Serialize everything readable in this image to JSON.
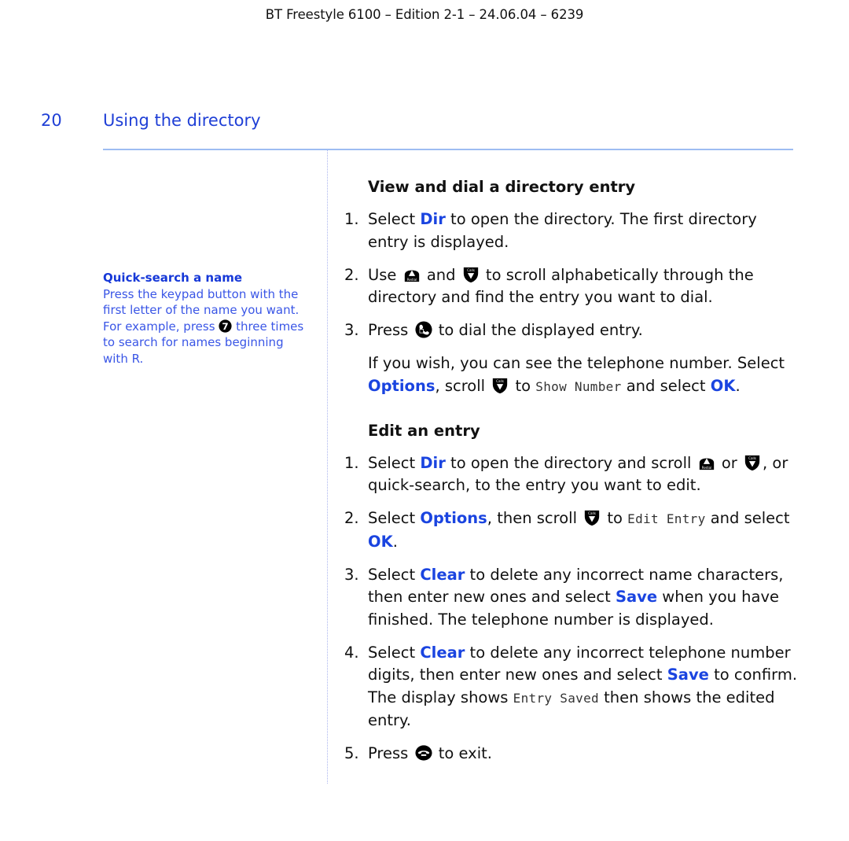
{
  "header": {
    "text": "BT Freestyle 6100 – Edition 2-1 – 24.06.04 – 6239"
  },
  "page": {
    "number": "20",
    "section_title": "Using the directory"
  },
  "colors": {
    "accent": "#1a44e0",
    "rule": "#9dbcf2",
    "sidebar_text": "#3a56e6"
  },
  "sidebar": {
    "title": "Quick-search a name",
    "text_before": "Press the keypad button with the first letter of the name you want. For example, press ",
    "key_icon": "key-7-icon",
    "text_after": " three times to search for names beginning with R."
  },
  "view_section": {
    "heading": "View and dial a directory entry",
    "steps": [
      {
        "num": "1.",
        "parts": [
          "Select ",
          "Dir",
          " to open the directory. The first directory entry is displayed."
        ]
      },
      {
        "num": "2.",
        "parts": [
          "Use ",
          " and ",
          " to scroll alphabetically through the directory and find the entry you want to dial."
        ],
        "icons": [
          "redial-up-icon",
          "calls-down-icon"
        ]
      },
      {
        "num": "3.",
        "parts": [
          "Press ",
          " to dial the displayed entry."
        ],
        "icons": [
          "talk-icon"
        ]
      }
    ],
    "note": {
      "t1": "If you wish, you can see the telephone number. Select ",
      "kw1": "Options",
      "t2": ", scroll ",
      "t3": " to ",
      "lcd": "Show Number",
      "t4": " and select ",
      "kw2": "OK",
      "t5": "."
    }
  },
  "edit_section": {
    "heading": "Edit an entry",
    "step1": {
      "num": "1.",
      "t1": "Select ",
      "kw1": "Dir",
      "t2": " to open the directory and scroll ",
      "t3": " or ",
      "t4": ", or quick-search, to the entry you want to edit."
    },
    "step2": {
      "num": "2.",
      "t1": "Select ",
      "kw1": "Options",
      "t2": ", then scroll ",
      "t3": " to ",
      "lcd": "Edit Entry",
      "t4": " and select ",
      "kw2": "OK",
      "t5": "."
    },
    "step3": {
      "num": "3.",
      "t1": "Select ",
      "kw1": "Clear",
      "t2": " to delete any incorrect name characters, then enter new ones and select ",
      "kw2": "Save",
      "t3": " when you have finished. The telephone number is displayed."
    },
    "step4": {
      "num": "4.",
      "t1": "Select ",
      "kw1": "Clear",
      "t2": " to delete any incorrect telephone number digits, then enter new ones and select ",
      "kw2": "Save",
      "t3": " to confirm. The display shows ",
      "lcd": "Entry Saved",
      "t4": " then shows the edited entry."
    },
    "step5": {
      "num": "5.",
      "t1": "Press ",
      "t2": " to exit."
    }
  },
  "icon_labels": {
    "redial": "Redial",
    "calls": "Calls",
    "key7": "7"
  }
}
